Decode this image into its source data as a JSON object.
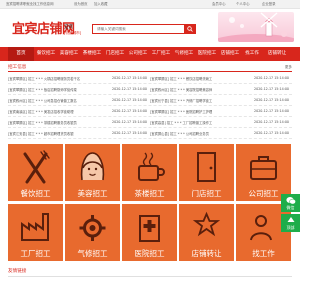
{
  "topbar": {
    "links": [
      "宜宾招聘求职就业找工作信息网",
      "设为首页",
      "加入收藏",
      "会员中心",
      "个人中心",
      "企业登录"
    ]
  },
  "header": {
    "logo": "宜宾店铺网",
    "city": "宜宾",
    "city_switch": "[切换城市]",
    "search_placeholder": "请输入关键词搜索"
  },
  "nav": {
    "items": [
      "首页",
      "餐饮招工",
      "美容招工",
      "茶楼招工",
      "门店招工",
      "公司招工",
      "工厂招工",
      "气修招工",
      "医院招工",
      "店铺招工"
    ],
    "extra": [
      "找工作",
      "店铺转让"
    ]
  },
  "latest": {
    "title": "招工信息",
    "more": "更多"
  },
  "jobs": {
    "left": [
      "[宜宾翠屏区] 招工 * * * 火锅店招聘服务员若干名",
      "[宜宾翠屏区] 招工 * * * 饭店招聘厨师学徒传菜",
      "[宜宾叙州区] 招工 * * * 公司急招仓管普工数名",
      "[宜宾南溪区] 招工 * * * 美发店招收学徒助理",
      "[宜宾翠屏区] 招工 * * * 茶楼招聘服务员收银员",
      "[宜宾江安县] 招工 * * * 超市招聘理货员收银",
      "[宜宾翠屏区] 招工 * * * 门店招聘导购员数名"
    ],
    "right": [
      "[宜宾翠屏区] 招工 * * * 餐饮店招聘洗碗工",
      "[宜宾叙州区] 招工 * * * 美容院招聘美容师",
      "[宜宾长宁县] 招工 * * * 汽修厂招聘学徒工",
      "[宜宾翠屏区] 招工 * * * 医院招聘护工护理",
      "[宜宾高县] 招工 * * * 工厂招聘普工操作工",
      "[宜宾屏山县] 招工 * * * 公司招聘业务员",
      "[宜宾翠屏区] 招工 * * * 店铺招聘店员数名"
    ],
    "date": "2020-12-17 15:14:00"
  },
  "tiles": [
    {
      "label": "餐饮招工",
      "icon": "fork-knife-icon"
    },
    {
      "label": "美容招工",
      "icon": "woman-face-icon"
    },
    {
      "label": "茶楼招工",
      "icon": "tea-cup-icon"
    },
    {
      "label": "门店招工",
      "icon": "shop-door-icon"
    },
    {
      "label": "公司招工",
      "icon": "briefcase-icon"
    },
    {
      "label": "工厂招工",
      "icon": "factory-icon"
    },
    {
      "label": "气修招工",
      "icon": "gear-icon"
    },
    {
      "label": "医院招工",
      "icon": "hospital-icon"
    },
    {
      "label": "店铺转让",
      "icon": "shop-transfer-icon"
    },
    {
      "label": "找工作",
      "icon": "person-search-icon"
    }
  ],
  "friend": {
    "title": "友情链接"
  },
  "float": {
    "wechat": "微信",
    "top": "顶部"
  },
  "colors": {
    "brand_red": "#d8261c",
    "tile_orange": "#e86a2e",
    "float_green": "#1fad4a"
  }
}
